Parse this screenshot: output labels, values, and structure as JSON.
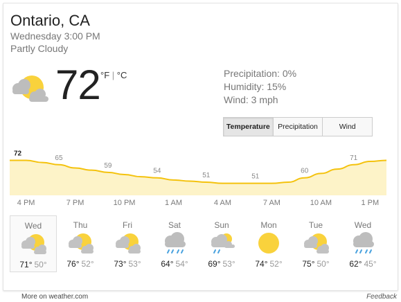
{
  "location": "Ontario, CA",
  "datetime": "Wednesday 3:00 PM",
  "condition": "Partly Cloudy",
  "current": {
    "temp": "72",
    "unit_f": "°F",
    "unit_sep": " | ",
    "unit_c": "°C",
    "icon": "partly-cloudy-icon"
  },
  "stats": {
    "precipitation": "Precipitation: 0%",
    "humidity": "Humidity: 15%",
    "wind": "Wind: 3 mph"
  },
  "tabs": [
    {
      "label": "Temperature",
      "active": true
    },
    {
      "label": "Precipitation",
      "active": false
    },
    {
      "label": "Wind",
      "active": false
    }
  ],
  "chart_data": {
    "type": "area",
    "x": [
      "3 PM",
      "4 PM",
      "5 PM",
      "6 PM",
      "7 PM",
      "8 PM",
      "9 PM",
      "10 PM",
      "11 PM",
      "12 AM",
      "1 AM",
      "2 AM",
      "3 AM",
      "4 AM",
      "5 AM",
      "6 AM",
      "7 AM",
      "8 AM",
      "9 AM",
      "10 AM",
      "11 AM",
      "12 PM",
      "1 PM",
      "2 PM"
    ],
    "values": [
      72,
      72,
      70,
      68,
      65,
      63,
      61,
      59,
      57,
      56,
      54,
      53,
      52,
      51,
      51,
      51,
      51,
      52,
      56,
      60,
      64,
      68,
      71,
      72
    ],
    "data_labels": [
      {
        "x": "3 PM",
        "label": "72"
      },
      {
        "x": "6 PM",
        "label": "65"
      },
      {
        "x": "9 PM",
        "label": "59"
      },
      {
        "x": "12 AM",
        "label": "54"
      },
      {
        "x": "3 AM",
        "label": "51"
      },
      {
        "x": "6 AM",
        "label": "51"
      },
      {
        "x": "9 AM",
        "label": "60"
      },
      {
        "x": "12 PM",
        "label": "71"
      }
    ],
    "tick_labels": [
      "4 PM",
      "7 PM",
      "10 PM",
      "1 AM",
      "4 AM",
      "7 AM",
      "10 AM",
      "1 PM"
    ],
    "ylim": [
      40,
      78
    ],
    "grid": false,
    "line_color": "#f4c20d",
    "fill_color": "#fdf3c8"
  },
  "days": [
    {
      "name": "Wed",
      "icon": "partly-cloudy-icon",
      "hi": "71°",
      "lo": "50°",
      "selected": true
    },
    {
      "name": "Thu",
      "icon": "partly-cloudy-icon",
      "hi": "76°",
      "lo": "52°",
      "selected": false
    },
    {
      "name": "Fri",
      "icon": "partly-cloudy-icon",
      "hi": "73°",
      "lo": "53°",
      "selected": false
    },
    {
      "name": "Sat",
      "icon": "rain-icon",
      "hi": "64°",
      "lo": "54°",
      "selected": false
    },
    {
      "name": "Sun",
      "icon": "rain-partly-cloudy-icon",
      "hi": "69°",
      "lo": "53°",
      "selected": false
    },
    {
      "name": "Mon",
      "icon": "sun-icon",
      "hi": "74°",
      "lo": "52°",
      "selected": false
    },
    {
      "name": "Tue",
      "icon": "partly-cloudy-icon",
      "hi": "75°",
      "lo": "50°",
      "selected": false
    },
    {
      "name": "Wed",
      "icon": "rain-icon",
      "hi": "62°",
      "lo": "45°",
      "selected": false
    }
  ],
  "footer": {
    "source": "More on weather.com",
    "feedback": "Feedback"
  },
  "colors": {
    "sun": "#f9d23c",
    "cloud": "#c8c8c8",
    "rain": "#4aa3df"
  }
}
